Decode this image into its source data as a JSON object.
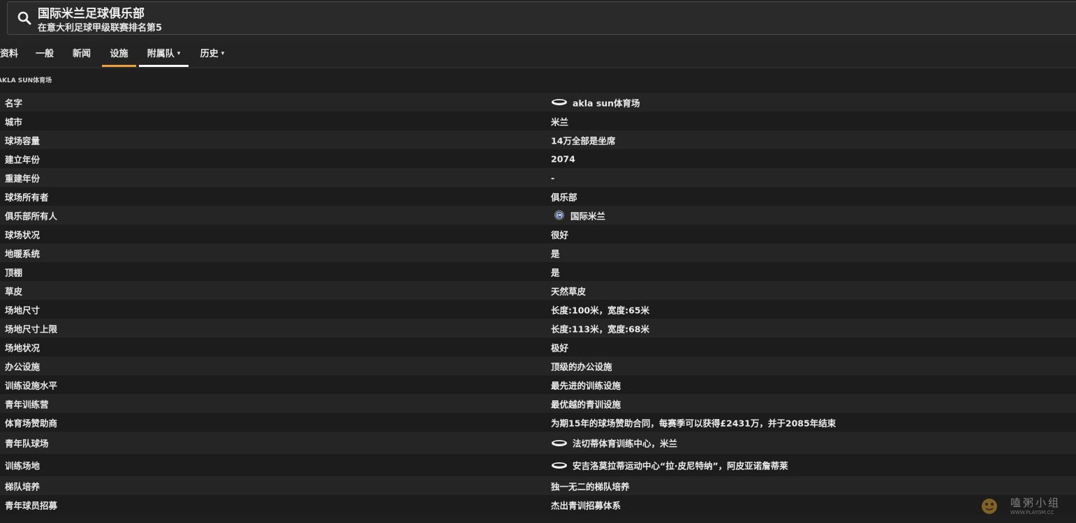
{
  "header": {
    "club_name": "国际米兰足球俱乐部",
    "subtitle": "在意大利足球甲级联赛排名第5",
    "search_icon": "search-icon"
  },
  "tabs": [
    {
      "label": "资料",
      "dropdown": false,
      "active": false
    },
    {
      "label": "一般",
      "dropdown": false,
      "active": false
    },
    {
      "label": "新闻",
      "dropdown": false,
      "active": false
    },
    {
      "label": "设施",
      "dropdown": false,
      "active": true
    },
    {
      "label": "附属队",
      "dropdown": true,
      "active": false
    },
    {
      "label": "历史",
      "dropdown": true,
      "active": false
    }
  ],
  "colors": {
    "active_tab": "#f0a23a",
    "hover_tab": "#ffffff"
  },
  "section": {
    "label": "AKLA SUN体育场"
  },
  "facilities": [
    {
      "key": "名字",
      "value": "akla sun体育场",
      "icon": "stadium-icon"
    },
    {
      "key": "城市",
      "value": "米兰"
    },
    {
      "key": "球场容量",
      "value": "14万全部是坐席"
    },
    {
      "key": "建立年份",
      "value": "2074"
    },
    {
      "key": "重建年份",
      "value": "-"
    },
    {
      "key": "球场所有者",
      "value": "俱乐部"
    },
    {
      "key": "俱乐部所有人",
      "value": "国际米兰",
      "icon": "club-crest-icon"
    },
    {
      "key": "球场状况",
      "value": "很好"
    },
    {
      "key": "地暖系统",
      "value": "是"
    },
    {
      "key": "顶棚",
      "value": "是"
    },
    {
      "key": "草皮",
      "value": "天然草皮"
    },
    {
      "key": "场地尺寸",
      "value": "长度:100米，宽度:65米"
    },
    {
      "key": "场地尺寸上限",
      "value": "长度:113米，宽度:68米"
    },
    {
      "key": "场地状况",
      "value": "极好"
    },
    {
      "key": "办公设施",
      "value": "顶级的办公设施"
    },
    {
      "key": "训练设施水平",
      "value": "最先进的训练设施"
    },
    {
      "key": "青年训练营",
      "value": "最优越的青训设施"
    },
    {
      "key": "体育场赞助商",
      "value": "为期15年的球场赞助合同，每赛季可以获得£2431万，并于2085年结束"
    },
    {
      "key": "青年队球场",
      "value": "法切蒂体育训练中心，米兰",
      "icon": "stadium-icon"
    },
    {
      "key": "训练场地",
      "value": "安吉洛莫拉蒂运动中心“拉·皮尼特纳”，阿皮亚诺詹蒂莱",
      "icon": "stadium-icon"
    },
    {
      "key": "梯队培养",
      "value": "独一无二的梯队培养"
    },
    {
      "key": "青年球员招募",
      "value": "杰出青训招募体系"
    }
  ],
  "watermark": {
    "title": "嗑粥小组",
    "url": "WWW.PLAYGM.CC"
  }
}
